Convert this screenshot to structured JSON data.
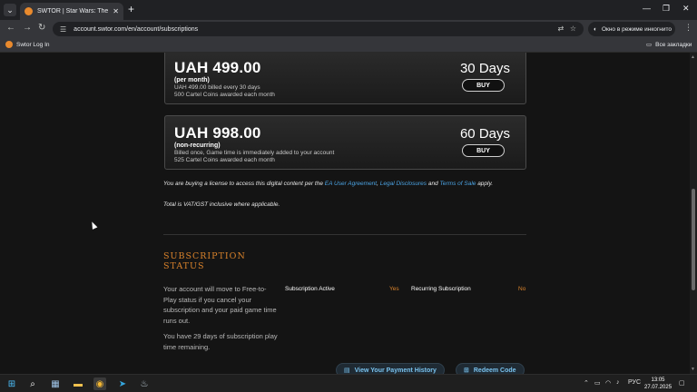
{
  "browser": {
    "tab_title": "SWTOR | Star Wars: The Old Re",
    "url": "account.swtor.com/en/account/subscriptions",
    "incognito_label": "Окно в режиме инкогнито",
    "bookmark": "Swtor Log In",
    "all_bookmarks": "Все закладки"
  },
  "plans": [
    {
      "price": "UAH 499.00",
      "type": "(per month)",
      "line1": "UAH 499.00 billed every 30 days",
      "line2": "500 Cartel Coins awarded each month",
      "days": "30 Days",
      "buy": "BUY"
    },
    {
      "price": "UAH 998.00",
      "type": "(non-recurring)",
      "line1": "Billed once, Game time is immediately added to your account",
      "line2": "525 Cartel Coins awarded each month",
      "days": "60 Days",
      "buy": "BUY"
    }
  ],
  "license": {
    "prefix": "You are buying a license to access this digital content per the ",
    "link1": "EA User Agreement",
    "sep": ", ",
    "link2": "Legal Disclosures",
    "and": " and ",
    "link3": "Terms of Sale",
    "suffix": " apply."
  },
  "vat": "Total is VAT/GST inclusive where applicable.",
  "subscription": {
    "title": "SUBSCRIPTION STATUS",
    "desc1": "Your account will move to Free-to-Play status if you cancel your subscription and your paid game time runs out.",
    "desc2": "You have 29 days of subscription play time remaining.",
    "active_label": "Subscription Active",
    "active_value": "Yes",
    "recurring_label": "Recurring Subscription",
    "recurring_value": "No"
  },
  "actions": {
    "payment_history": "View Your Payment History",
    "redeem": "Redeem Code"
  },
  "taskbar": {
    "lang": "РУС",
    "time": "13:05",
    "date": "27.07.2025"
  }
}
